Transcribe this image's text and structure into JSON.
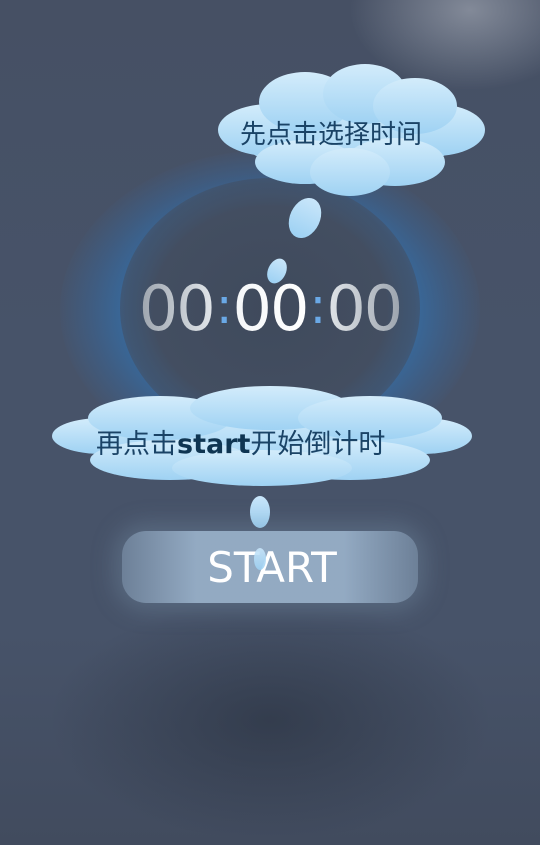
{
  "timer": {
    "hours": "00",
    "minutes": "00",
    "seconds": "00",
    "separator": ":"
  },
  "hints": {
    "select_time": "先点击选择时间",
    "start_prefix": "再点击",
    "start_keyword": "start",
    "start_suffix": "开始倒计时"
  },
  "start_button": {
    "label": "START"
  },
  "colors": {
    "background": "#465064",
    "glow": "#2a8cdc",
    "cloud": "#b3dcf6",
    "cloud_text": "#1a4366",
    "colon": "#6aa9e6"
  },
  "icons": [
    "cloud-bubble-icon",
    "water-drop-icon"
  ]
}
